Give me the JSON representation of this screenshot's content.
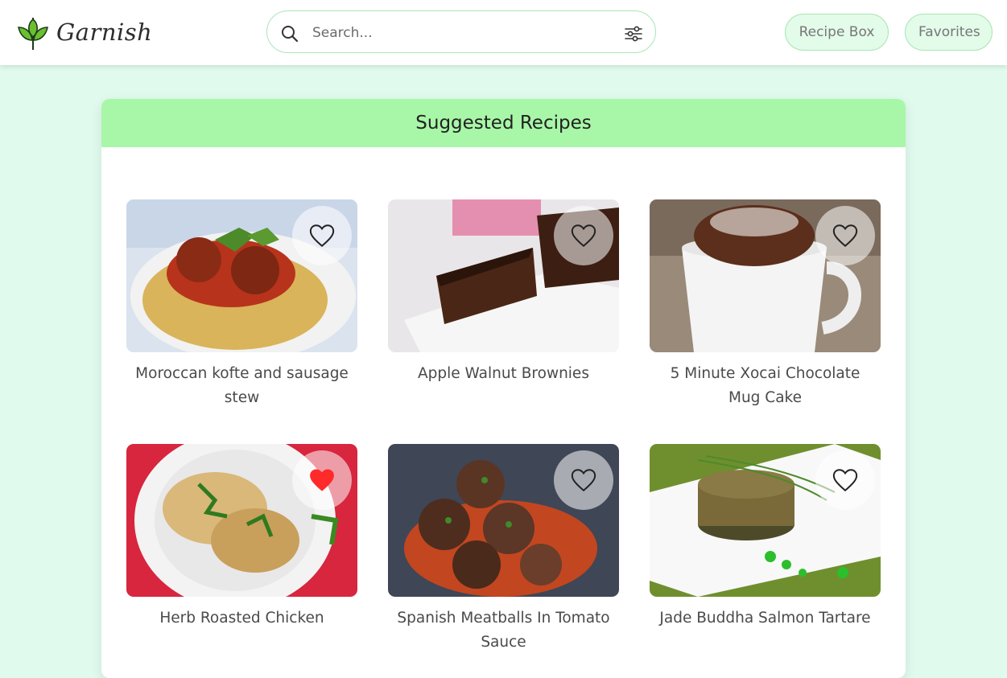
{
  "header": {
    "brand_name": "Garnish",
    "search_placeholder": "Search...",
    "nav": {
      "recipe_box": "Recipe Box",
      "favorites": "Favorites"
    }
  },
  "colors": {
    "page_bg": "#e0fbee",
    "header_band": "#a8f7a8",
    "accent_border": "#a8e6b4",
    "favorite_active": "#ff2a2a"
  },
  "main": {
    "title": "Suggested Recipes",
    "recipes": [
      {
        "title": "Moroccan kofte and sausage stew",
        "favorited": false,
        "icon": "heart-outline-icon"
      },
      {
        "title": "Apple Walnut Brownies",
        "favorited": false,
        "icon": "heart-outline-icon"
      },
      {
        "title": "5 Minute Xocai Chocolate Mug Cake",
        "favorited": false,
        "icon": "heart-outline-icon"
      },
      {
        "title": "Herb Roasted Chicken",
        "favorited": true,
        "icon": "heart-filled-icon"
      },
      {
        "title": "Spanish Meatballs In Tomato Sauce",
        "favorited": false,
        "icon": "heart-outline-icon"
      },
      {
        "title": "Jade Buddha Salmon Tartare",
        "favorited": false,
        "icon": "heart-outline-icon"
      }
    ]
  }
}
